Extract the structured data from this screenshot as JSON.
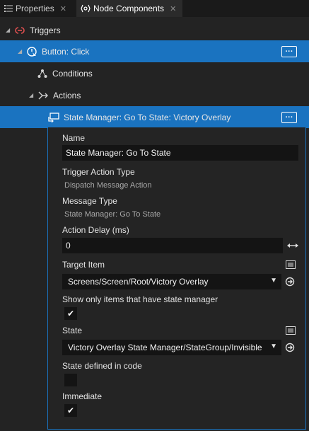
{
  "tabs": [
    {
      "label": "Properties",
      "icon": "list-icon"
    },
    {
      "label": "Node Components",
      "icon": "node-components-icon"
    }
  ],
  "tree": {
    "triggers_label": "Triggers",
    "button_click_label": "Button: Click",
    "conditions_label": "Conditions",
    "actions_label": "Actions",
    "state_action_label": "State Manager: Go To State: Victory Overlay"
  },
  "panel": {
    "name_label": "Name",
    "name_value": "State Manager: Go To State",
    "trigger_action_type_label": "Trigger Action Type",
    "trigger_action_type_value": "Dispatch Message Action",
    "message_type_label": "Message Type",
    "message_type_value": "State Manager: Go To State",
    "action_delay_label": "Action Delay (ms)",
    "action_delay_value": "0",
    "target_item_label": "Target Item",
    "target_item_value": "Screens/Screen/Root/Victory Overlay",
    "show_only_label": "Show only items that have state manager",
    "show_only_checked": true,
    "state_label": "State",
    "state_value": "Victory Overlay State Manager/StateGroup/Invisible",
    "state_in_code_label": "State defined in code",
    "state_in_code_checked": false,
    "immediate_label": "Immediate",
    "immediate_checked": true
  },
  "colors": {
    "selection": "#1a73c0",
    "background": "#232323",
    "field": "#141414",
    "trigger_icon": "#e05050"
  }
}
